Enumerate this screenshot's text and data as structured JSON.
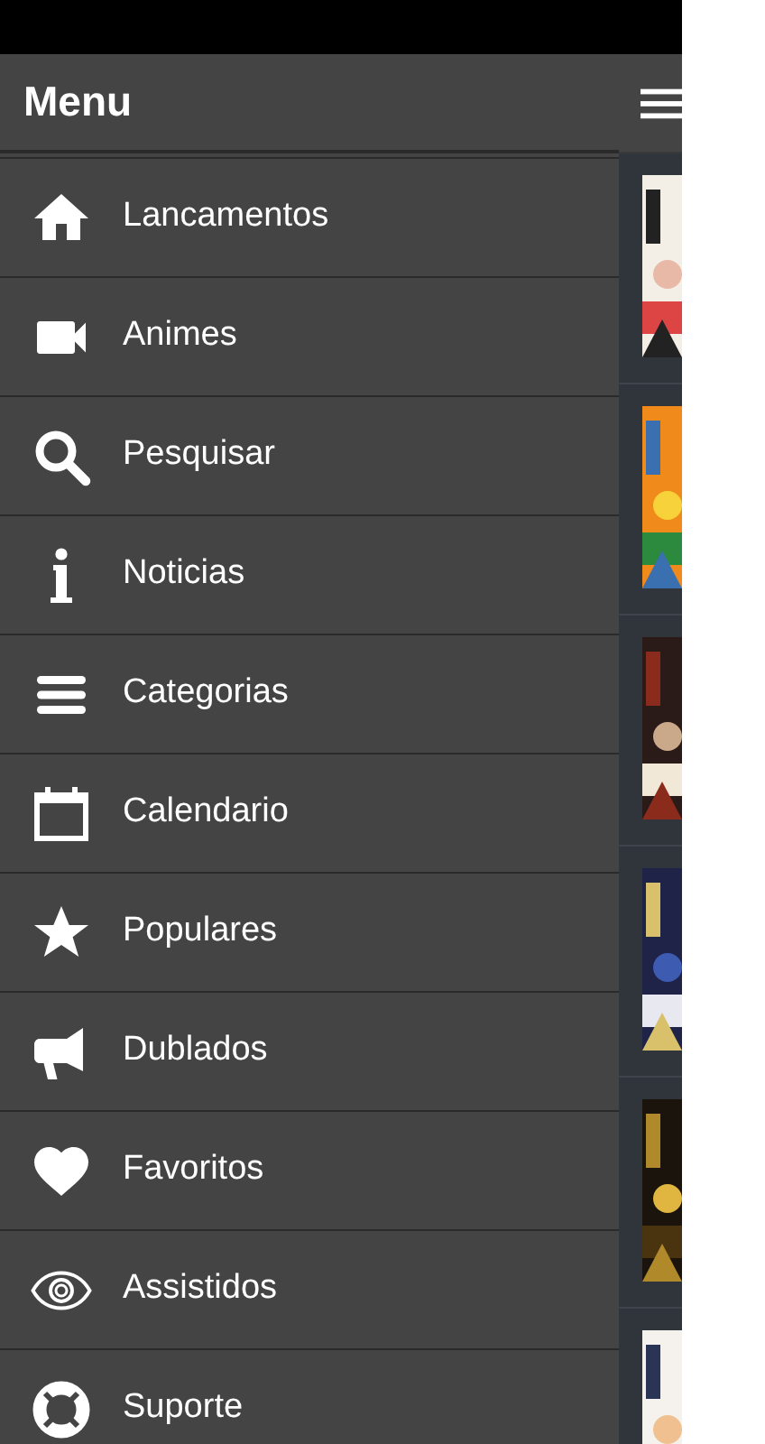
{
  "drawer": {
    "title": "Menu",
    "items": [
      {
        "label": "Lancamentos"
      },
      {
        "label": "Animes"
      },
      {
        "label": "Pesquisar"
      },
      {
        "label": "Noticias"
      },
      {
        "label": "Categorias"
      },
      {
        "label": "Calendario"
      },
      {
        "label": "Populares"
      },
      {
        "label": "Dublados"
      },
      {
        "label": "Favoritos"
      },
      {
        "label": "Assistidos"
      },
      {
        "label": "Suporte"
      }
    ]
  }
}
